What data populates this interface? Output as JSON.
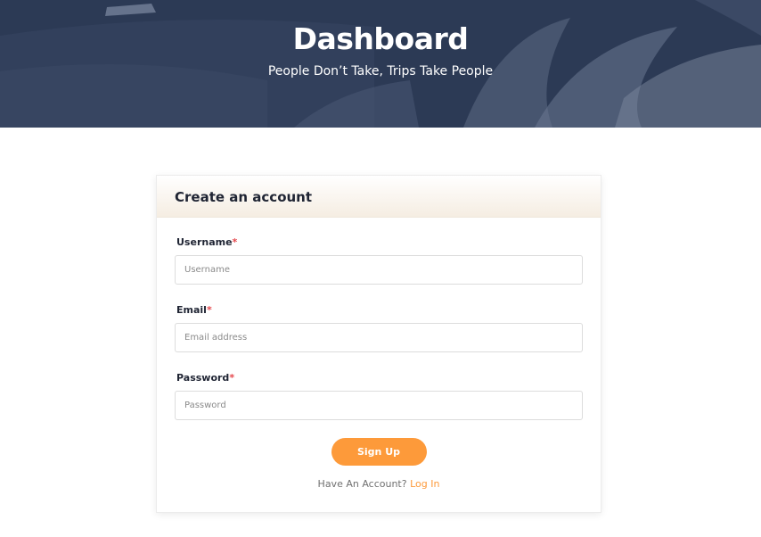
{
  "hero": {
    "title": "Dashboard",
    "subtitle": "People Don’t Take, Trips Take People"
  },
  "card": {
    "title": "Create an account",
    "fields": [
      {
        "label": "Username",
        "required_mark": "*",
        "placeholder": "Username",
        "value": ""
      },
      {
        "label": "Email",
        "required_mark": "*",
        "placeholder": "Email address",
        "value": ""
      },
      {
        "label": "Password",
        "required_mark": "*",
        "placeholder": "Password",
        "value": ""
      }
    ],
    "submit_label": "Sign Up",
    "footer_text": "Have An Account?",
    "footer_link": "Log In"
  },
  "colors": {
    "accent": "#fd9a3a",
    "required": "#e5484d",
    "hero_overlay": "#2f3d58"
  }
}
